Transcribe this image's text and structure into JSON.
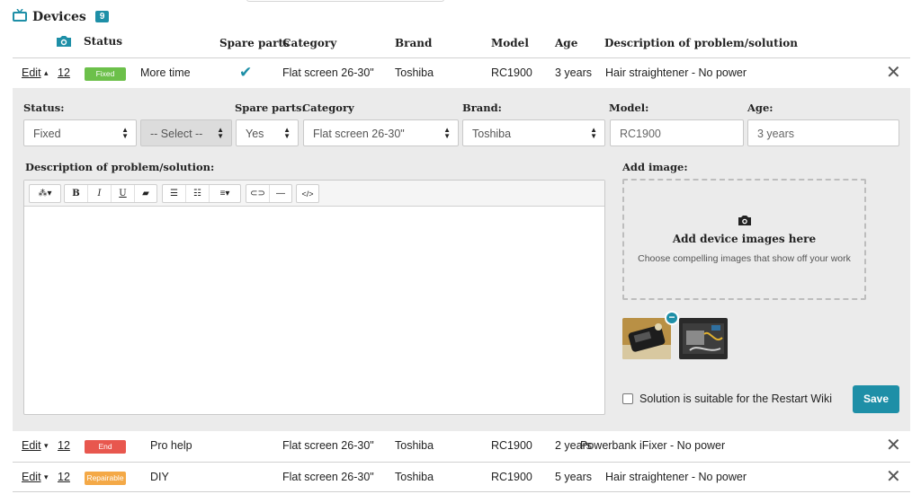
{
  "title": "Devices",
  "device_count": "9",
  "columns": {
    "status": "Status",
    "spare_parts": "Spare parts",
    "category": "Category",
    "brand": "Brand",
    "model": "Model",
    "age": "Age",
    "description": "Description of problem/solution"
  },
  "rows": [
    {
      "edit": "Edit",
      "caret": "▴",
      "num": "12",
      "status": "Fixed",
      "status_color": "#6cc04a",
      "repair": "More time",
      "spare": "✔",
      "category": "Flat screen 26-30\"",
      "brand": "Toshiba",
      "model": "RC1900",
      "age": "3 years",
      "description": "Hair straightener - No power"
    },
    {
      "edit": "Edit",
      "caret": "▾",
      "num": "12",
      "status": "End",
      "status_color": "#e8574e",
      "repair": "Pro help",
      "spare": "",
      "category": "Flat screen 26-30\"",
      "brand": "Toshiba",
      "model": "RC1900",
      "age": "2 years",
      "description": "Powerbank iFixer - No power"
    },
    {
      "edit": "Edit",
      "caret": "▾",
      "num": "12",
      "status": "Repairable",
      "status_color": "#f4a947",
      "repair": "DIY",
      "spare": "",
      "category": "Flat screen 26-30\"",
      "brand": "Toshiba",
      "model": "RC1900",
      "age": "5 years",
      "description": "Hair straightener - No power"
    }
  ],
  "form": {
    "status_label": "Status:",
    "spare_label": "Spare parts:",
    "category_label": "Category",
    "brand_label": "Brand:",
    "model_label": "Model:",
    "age_label": "Age:",
    "status_value": "Fixed",
    "repair_value": "-- Select --",
    "spare_value": "Yes",
    "category_value": "Flat screen 26-30\"",
    "brand_value": "Toshiba",
    "model_value": "RC1900",
    "age_value": "3 years",
    "description_label": "Description of problem/solution:",
    "add_image_label": "Add image:",
    "dropzone_title": "Add device images here",
    "dropzone_hint": "Choose compelling images that show off your work",
    "wiki_label": "Solution is suitable for the Restart Wiki",
    "save_label": "Save"
  },
  "toolbar": [
    "magic-wand",
    "B",
    "I",
    "U",
    "eraser",
    "unordered-list",
    "ordered-list",
    "align",
    "link",
    "horizontal-rule",
    "code"
  ],
  "colors": {
    "accent": "#1e8fa7",
    "fixed": "#6cc04a",
    "end": "#e8574e",
    "repairable": "#f4a947"
  }
}
